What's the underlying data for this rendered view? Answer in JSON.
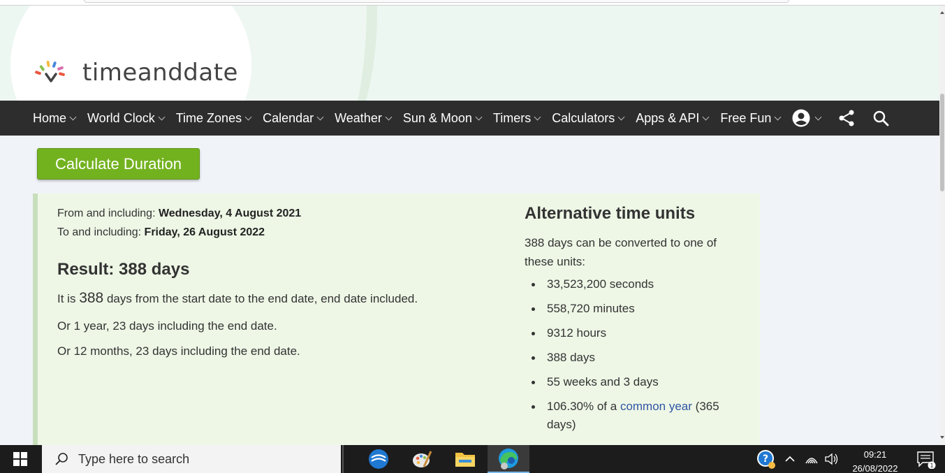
{
  "logo": {
    "text": "timeanddate"
  },
  "nav": {
    "items": [
      "Home",
      "World Clock",
      "Time Zones",
      "Calendar",
      "Weather",
      "Sun & Moon",
      "Timers",
      "Calculators",
      "Apps & API",
      "Free Fun"
    ],
    "icons": [
      "account-icon",
      "share-icon",
      "search-icon"
    ]
  },
  "calc_button": "Calculate Duration",
  "result": {
    "from_label": "From and including:",
    "from_value": "Wednesday, 4 August 2021",
    "to_label": "To and including:",
    "to_value": "Friday, 26 August 2022",
    "title": "Result: 388 days",
    "line1_prefix": "It is",
    "line1_num": "388",
    "line1_suffix": "days from the start date to the end date, end date included.",
    "line2": "Or 1 year, 23 days including the end date.",
    "line3": "Or 12 months, 23 days including the end date."
  },
  "alt_units": {
    "title": "Alternative time units",
    "intro": "388 days can be converted to one of these units:",
    "items": [
      "33,523,200 seconds",
      "558,720 minutes",
      "9312 hours",
      "388 days",
      "55 weeks and 3 days"
    ],
    "last_prefix": "106.30% of a",
    "last_link": "common year",
    "last_suffix": "(365 days)"
  },
  "taskbar": {
    "search_placeholder": "Type here to search",
    "time": "09:21",
    "date": "26/08/2022",
    "notification_count": "1"
  },
  "colors": {
    "nav_bg": "#2d2d2d",
    "button_green": "#73b21f",
    "panel_bg": "#eef7e6",
    "link": "#2f55a4"
  }
}
